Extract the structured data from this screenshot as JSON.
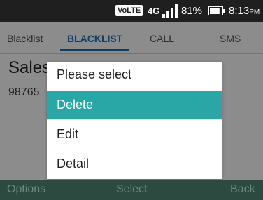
{
  "status_bar": {
    "volte": "VoLTE",
    "network": "4G",
    "battery_percent": "81%",
    "battery_level": 0.81,
    "time": "8:13",
    "ampm": "PM"
  },
  "header": {
    "title": "Blacklist",
    "tabs": [
      {
        "label": "BLACKLIST",
        "active": true
      },
      {
        "label": "CALL",
        "active": false
      },
      {
        "label": "SMS",
        "active": false
      }
    ]
  },
  "content": {
    "contact_name": "Sales",
    "contact_number": "98765"
  },
  "dialog": {
    "title": "Please select",
    "options": [
      {
        "label": "Delete",
        "selected": true
      },
      {
        "label": "Edit",
        "selected": false
      },
      {
        "label": "Detail",
        "selected": false
      }
    ]
  },
  "softkeys": {
    "left": "Options",
    "center": "Select",
    "right": "Back"
  },
  "colors": {
    "accent": "#29a6a6",
    "tab_active": "#1e6fb8",
    "softkey_bar": "#2c4a3f",
    "status_bar": "#1f1f1f"
  }
}
